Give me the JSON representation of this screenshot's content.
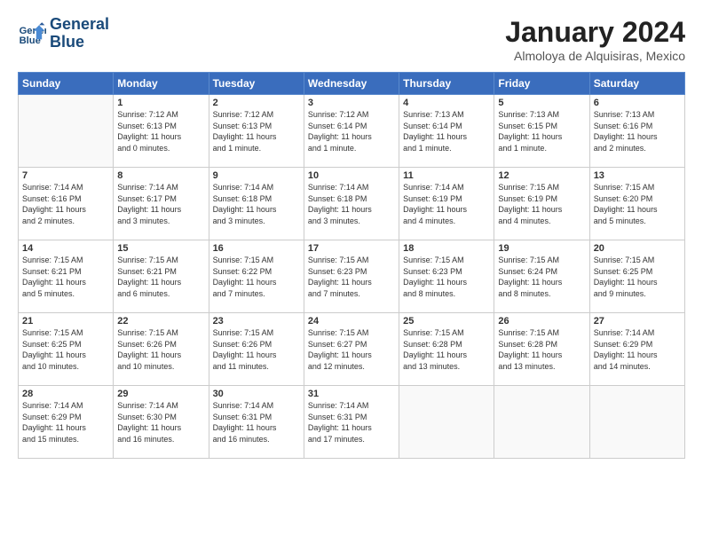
{
  "header": {
    "logo_line1": "General",
    "logo_line2": "Blue",
    "month_title": "January 2024",
    "location": "Almoloya de Alquisiras, Mexico"
  },
  "days_of_week": [
    "Sunday",
    "Monday",
    "Tuesday",
    "Wednesday",
    "Thursday",
    "Friday",
    "Saturday"
  ],
  "weeks": [
    [
      {
        "num": "",
        "info": ""
      },
      {
        "num": "1",
        "info": "Sunrise: 7:12 AM\nSunset: 6:13 PM\nDaylight: 11 hours\nand 0 minutes."
      },
      {
        "num": "2",
        "info": "Sunrise: 7:12 AM\nSunset: 6:13 PM\nDaylight: 11 hours\nand 1 minute."
      },
      {
        "num": "3",
        "info": "Sunrise: 7:12 AM\nSunset: 6:14 PM\nDaylight: 11 hours\nand 1 minute."
      },
      {
        "num": "4",
        "info": "Sunrise: 7:13 AM\nSunset: 6:14 PM\nDaylight: 11 hours\nand 1 minute."
      },
      {
        "num": "5",
        "info": "Sunrise: 7:13 AM\nSunset: 6:15 PM\nDaylight: 11 hours\nand 1 minute."
      },
      {
        "num": "6",
        "info": "Sunrise: 7:13 AM\nSunset: 6:16 PM\nDaylight: 11 hours\nand 2 minutes."
      }
    ],
    [
      {
        "num": "7",
        "info": "Sunrise: 7:14 AM\nSunset: 6:16 PM\nDaylight: 11 hours\nand 2 minutes."
      },
      {
        "num": "8",
        "info": "Sunrise: 7:14 AM\nSunset: 6:17 PM\nDaylight: 11 hours\nand 3 minutes."
      },
      {
        "num": "9",
        "info": "Sunrise: 7:14 AM\nSunset: 6:18 PM\nDaylight: 11 hours\nand 3 minutes."
      },
      {
        "num": "10",
        "info": "Sunrise: 7:14 AM\nSunset: 6:18 PM\nDaylight: 11 hours\nand 3 minutes."
      },
      {
        "num": "11",
        "info": "Sunrise: 7:14 AM\nSunset: 6:19 PM\nDaylight: 11 hours\nand 4 minutes."
      },
      {
        "num": "12",
        "info": "Sunrise: 7:15 AM\nSunset: 6:19 PM\nDaylight: 11 hours\nand 4 minutes."
      },
      {
        "num": "13",
        "info": "Sunrise: 7:15 AM\nSunset: 6:20 PM\nDaylight: 11 hours\nand 5 minutes."
      }
    ],
    [
      {
        "num": "14",
        "info": "Sunrise: 7:15 AM\nSunset: 6:21 PM\nDaylight: 11 hours\nand 5 minutes."
      },
      {
        "num": "15",
        "info": "Sunrise: 7:15 AM\nSunset: 6:21 PM\nDaylight: 11 hours\nand 6 minutes."
      },
      {
        "num": "16",
        "info": "Sunrise: 7:15 AM\nSunset: 6:22 PM\nDaylight: 11 hours\nand 7 minutes."
      },
      {
        "num": "17",
        "info": "Sunrise: 7:15 AM\nSunset: 6:23 PM\nDaylight: 11 hours\nand 7 minutes."
      },
      {
        "num": "18",
        "info": "Sunrise: 7:15 AM\nSunset: 6:23 PM\nDaylight: 11 hours\nand 8 minutes."
      },
      {
        "num": "19",
        "info": "Sunrise: 7:15 AM\nSunset: 6:24 PM\nDaylight: 11 hours\nand 8 minutes."
      },
      {
        "num": "20",
        "info": "Sunrise: 7:15 AM\nSunset: 6:25 PM\nDaylight: 11 hours\nand 9 minutes."
      }
    ],
    [
      {
        "num": "21",
        "info": "Sunrise: 7:15 AM\nSunset: 6:25 PM\nDaylight: 11 hours\nand 10 minutes."
      },
      {
        "num": "22",
        "info": "Sunrise: 7:15 AM\nSunset: 6:26 PM\nDaylight: 11 hours\nand 10 minutes."
      },
      {
        "num": "23",
        "info": "Sunrise: 7:15 AM\nSunset: 6:26 PM\nDaylight: 11 hours\nand 11 minutes."
      },
      {
        "num": "24",
        "info": "Sunrise: 7:15 AM\nSunset: 6:27 PM\nDaylight: 11 hours\nand 12 minutes."
      },
      {
        "num": "25",
        "info": "Sunrise: 7:15 AM\nSunset: 6:28 PM\nDaylight: 11 hours\nand 13 minutes."
      },
      {
        "num": "26",
        "info": "Sunrise: 7:15 AM\nSunset: 6:28 PM\nDaylight: 11 hours\nand 13 minutes."
      },
      {
        "num": "27",
        "info": "Sunrise: 7:14 AM\nSunset: 6:29 PM\nDaylight: 11 hours\nand 14 minutes."
      }
    ],
    [
      {
        "num": "28",
        "info": "Sunrise: 7:14 AM\nSunset: 6:29 PM\nDaylight: 11 hours\nand 15 minutes."
      },
      {
        "num": "29",
        "info": "Sunrise: 7:14 AM\nSunset: 6:30 PM\nDaylight: 11 hours\nand 16 minutes."
      },
      {
        "num": "30",
        "info": "Sunrise: 7:14 AM\nSunset: 6:31 PM\nDaylight: 11 hours\nand 16 minutes."
      },
      {
        "num": "31",
        "info": "Sunrise: 7:14 AM\nSunset: 6:31 PM\nDaylight: 11 hours\nand 17 minutes."
      },
      {
        "num": "",
        "info": ""
      },
      {
        "num": "",
        "info": ""
      },
      {
        "num": "",
        "info": ""
      }
    ]
  ]
}
